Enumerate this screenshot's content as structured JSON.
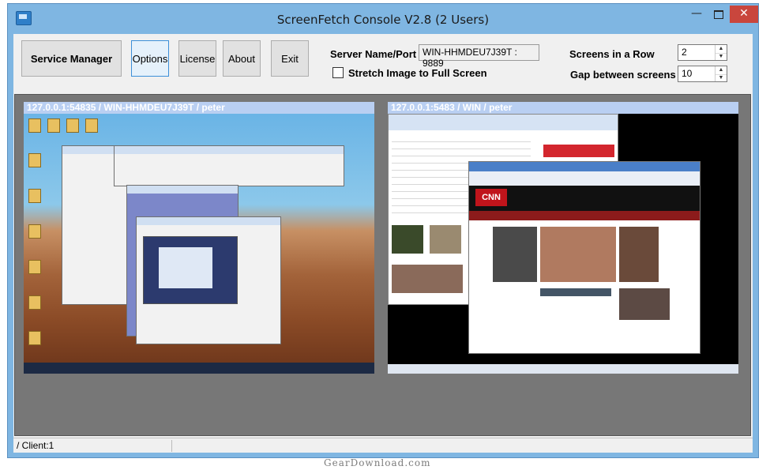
{
  "window": {
    "title": "ScreenFetch Console V2.8 (2 Users)",
    "controls": {
      "minimize": "—",
      "close": "✕"
    }
  },
  "toolbar": {
    "service_manager_label": "Service Manager",
    "options_label": "Options",
    "license_label": "License",
    "about_label": "About",
    "exit_label": "Exit"
  },
  "server": {
    "label": "Server Name/Port",
    "value": "WIN-HHMDEU7J39T : 9889"
  },
  "stretch": {
    "label": "Stretch Image to Full Screen",
    "checked": false
  },
  "layout_settings": {
    "screens_in_row_label": "Screens in a Row",
    "screens_in_row_value": "2",
    "gap_label": "Gap between screens",
    "gap_value": "10"
  },
  "screens": [
    {
      "header": "127.0.0.1:54835 / WIN-HHMDEU7J39T / peter"
    },
    {
      "header": "127.0.0.1:5483 / WIN  / peter"
    }
  ],
  "remote_content": {
    "cnn_logo": "CNN"
  },
  "status": {
    "client": "/ Client:1"
  },
  "watermark": "GearDownload.com",
  "colors": {
    "frame": "#7fb6e2",
    "header_bar": "#b9cff2",
    "close_button": "#c9463d",
    "screens_background": "#777777"
  }
}
